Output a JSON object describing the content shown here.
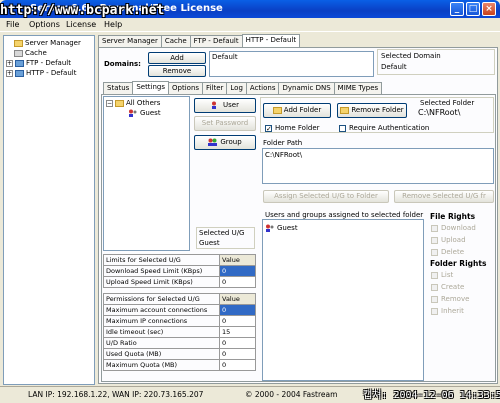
{
  "window": {
    "title": "Server 6.6 - Personal/Free License",
    "watermark": "http://www.bcpark.net",
    "min": "_",
    "max": "□",
    "close": "×"
  },
  "menu": [
    "File",
    "Options",
    "License",
    "Help"
  ],
  "tree": {
    "items": [
      {
        "label": "Server Manager",
        "expander": ""
      },
      {
        "label": "Cache",
        "expander": ""
      },
      {
        "label": "FTP - Default",
        "expander": "+"
      },
      {
        "label": "HTTP - Default",
        "expander": "+"
      }
    ]
  },
  "main_tabs": [
    "Server Manager",
    "Cache",
    "FTP - Default",
    "HTTP - Default"
  ],
  "domains": {
    "label": "Domains:",
    "add": "Add",
    "remove": "Remove",
    "value": "Default",
    "selected_label": "Selected Domain",
    "selected_value": "Default"
  },
  "sub_tabs": [
    "Status",
    "Settings",
    "Options",
    "Filter",
    "Log",
    "Actions",
    "Dynamic DNS",
    "MIME Types"
  ],
  "users": {
    "root": "All Others",
    "child": "Guest",
    "user_btn": "User",
    "setpw_btn": "Set Password",
    "group_btn": "Group",
    "selected_label": "Selected U/G",
    "selected_value": "Guest"
  },
  "limits": {
    "header": [
      "Limits for Selected U/G",
      "Value"
    ],
    "rows": [
      [
        "Download Speed Limit (KBps)",
        "0"
      ],
      [
        "Upload Speed Limit (KBps)",
        "0"
      ]
    ]
  },
  "permissions": {
    "header": [
      "Permissions for Selected U/G",
      "Value"
    ],
    "rows": [
      [
        "Maximum account connections",
        "0"
      ],
      [
        "Maximum IP connections",
        "0"
      ],
      [
        "Idle timeout (sec)",
        "15"
      ],
      [
        "U/D Ratio",
        "0"
      ],
      [
        "Used Quota (MB)",
        "0"
      ],
      [
        "Maximum Quota (MB)",
        "0"
      ]
    ]
  },
  "folders": {
    "add": "Add Folder",
    "remove": "Remove Folder",
    "selected_label": "Selected Folder",
    "selected_value": "C:\\NFRoot\\",
    "home_folder": "Home Folder",
    "require_auth": "Require Authentication",
    "path_label": "Folder Path",
    "path_value": "C:\\NFRoot\\",
    "assign": "Assign Selected U/G to Folder",
    "remove_ug": "Remove Selected U/G fr",
    "assigned_label": "Users and groups assigned to selected folder",
    "assigned_item": "Guest",
    "file_rights": "File Rights",
    "file_opts": [
      "Download",
      "Upload",
      "Delete"
    ],
    "folder_rights": "Folder Rights",
    "folder_opts": [
      "List",
      "Create",
      "Remove",
      "Inherit"
    ]
  },
  "status": {
    "lan": "LAN IP: 192.168.1.22,  WAN IP: 220.73.165.207",
    "copyright": "© 2000 - 2004 Fastream",
    "overlay": "캡쳐: 2004-12-06 14:33:56"
  }
}
